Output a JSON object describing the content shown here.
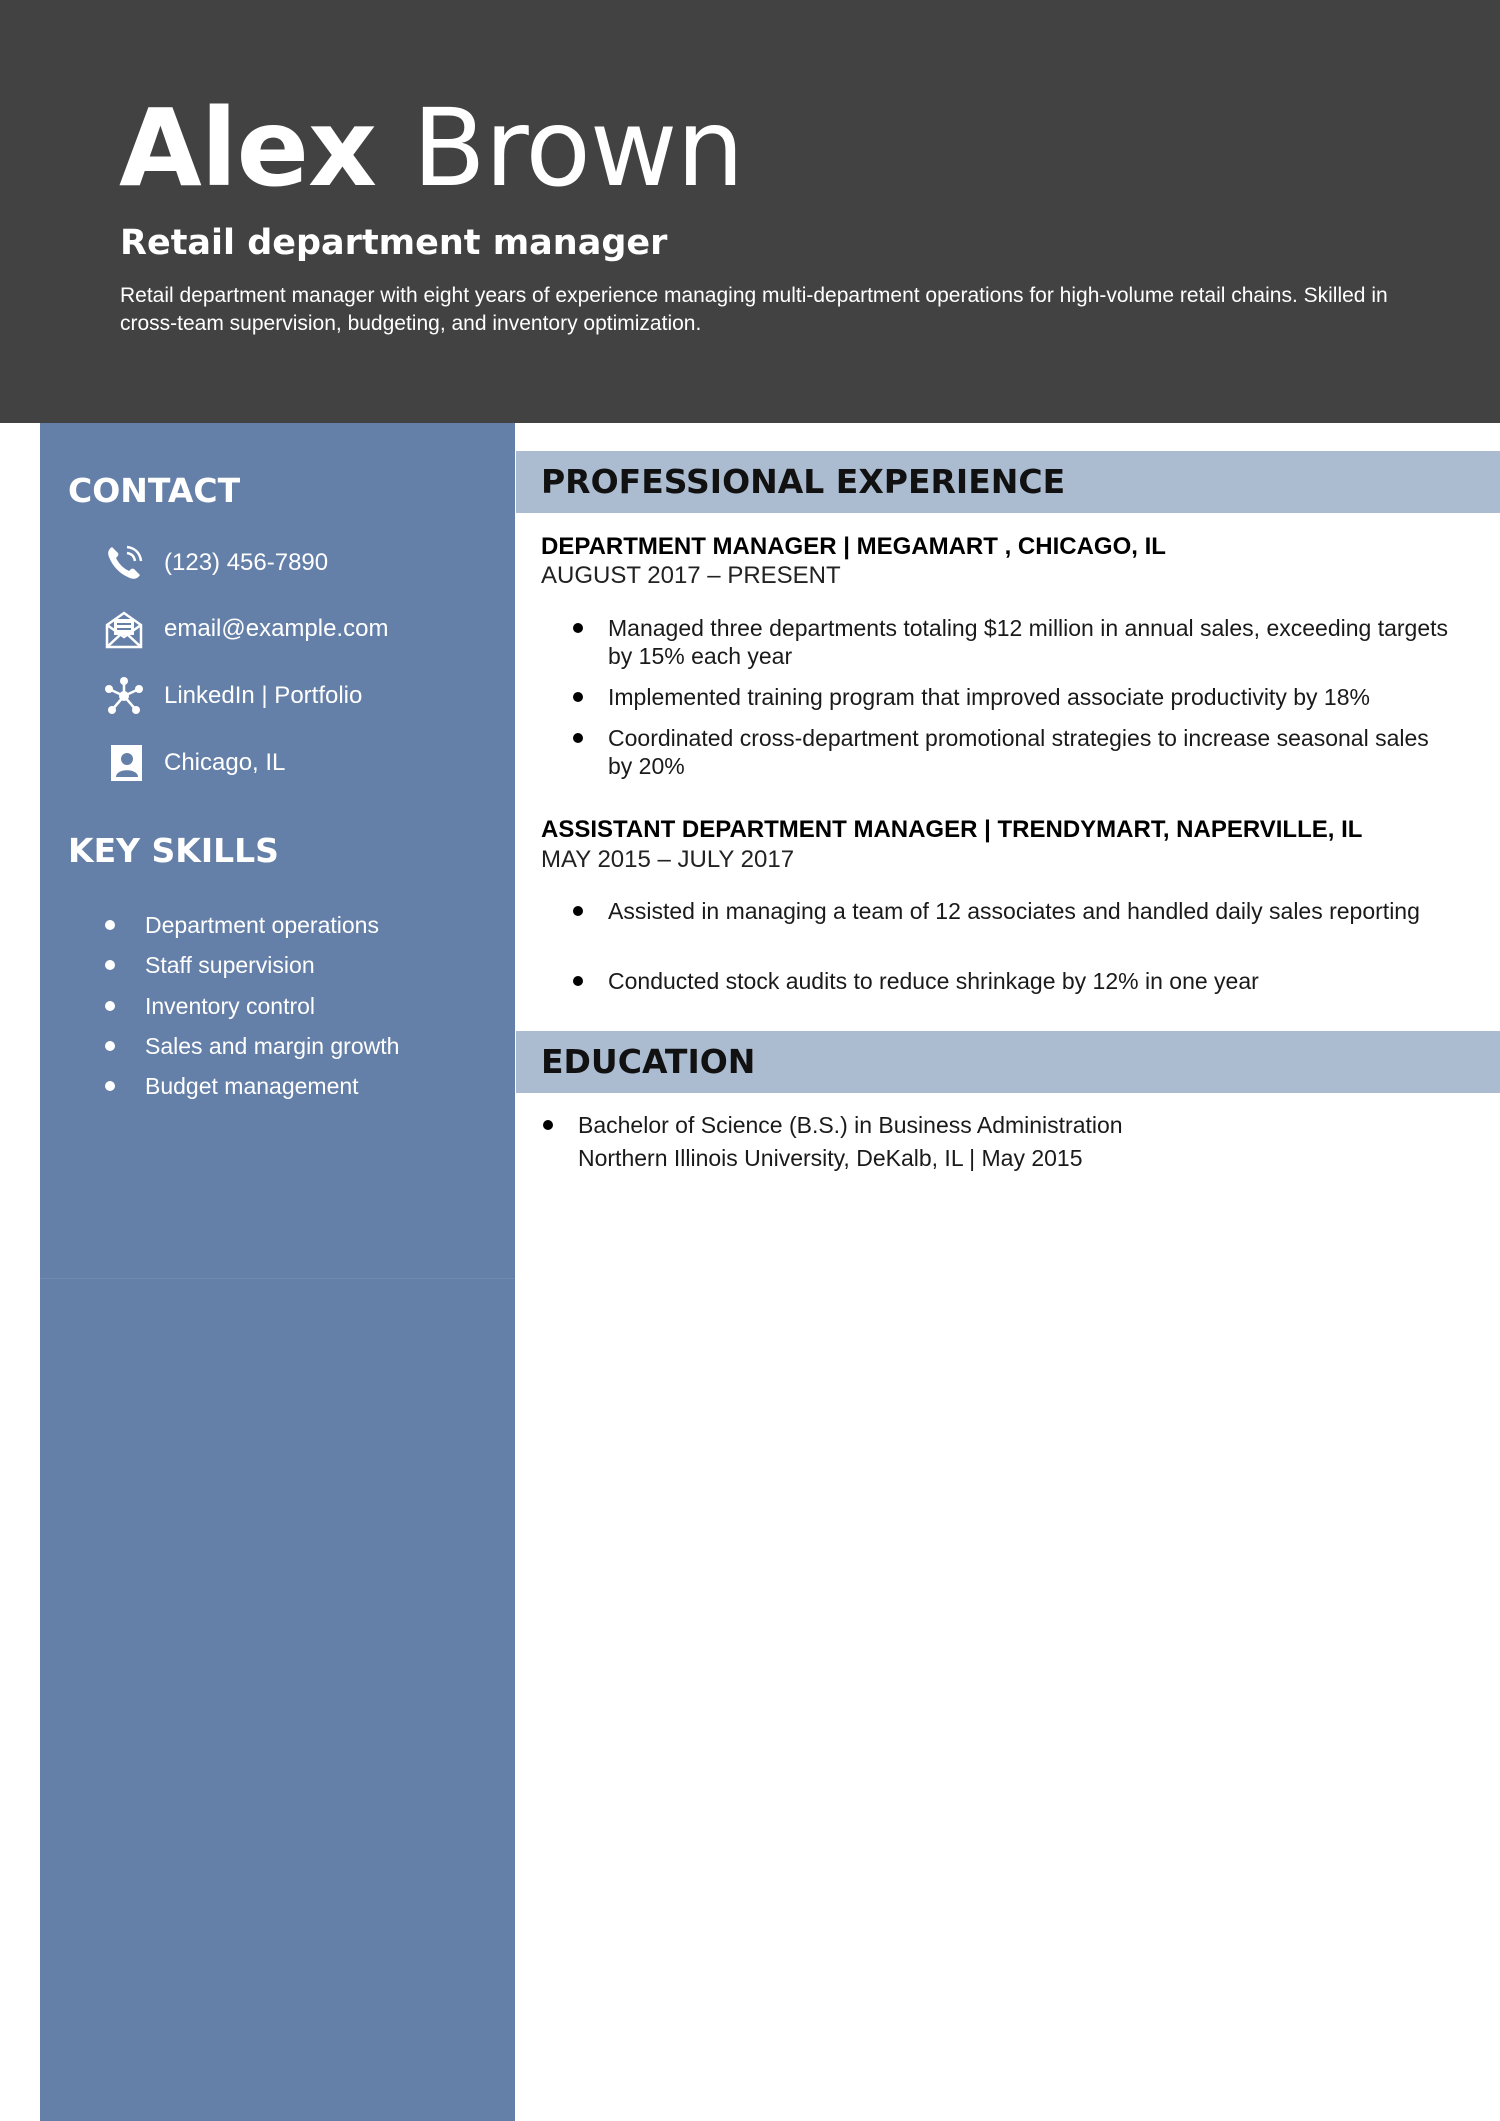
{
  "header": {
    "first_name": "Alex",
    "last_name": "Brown",
    "headline": "Retail department manager",
    "summary": "Retail department manager with eight years of experience managing multi-department operations for high-volume retail chains. Skilled in cross-team supervision, budgeting, and inventory optimization."
  },
  "sidebar": {
    "contact_heading": "CONTACT",
    "contact": [
      {
        "icon": "phone-icon",
        "text": "(123) 456-7890"
      },
      {
        "icon": "envelope-icon",
        "text": "email@example.com"
      },
      {
        "icon": "network-icon",
        "text": "LinkedIn | Portfolio"
      },
      {
        "icon": "contact-card-icon",
        "text": "Chicago, IL"
      }
    ],
    "skills_heading": "KEY SKILLS",
    "skills": [
      "Department operations",
      "Staff supervision",
      "Inventory control",
      "Sales and margin growth",
      "Budget management"
    ]
  },
  "experience": {
    "heading": "PROFESSIONAL EXPERIENCE",
    "jobs": [
      {
        "title": "DEPARTMENT MANAGER | MEGAMART , CHICAGO, IL",
        "dates": "AUGUST 2017 – PRESENT",
        "bullets": [
          "Managed three departments totaling $12 million in annual sales, exceeding targets by 15% each year",
          "Implemented training program that improved associate productivity by 18%",
          "Coordinated cross-department promotional strategies to increase seasonal sales by 20%"
        ]
      },
      {
        "title": "ASSISTANT DEPARTMENT MANAGER | TRENDYMART, NAPERVILLE, IL",
        "dates": "MAY 2015 – JULY 2017",
        "bullets": [
          "Assisted in managing a team of 12 associates and handled daily sales reporting",
          "Conducted stock audits to reduce shrinkage by 12% in one year"
        ]
      }
    ]
  },
  "education": {
    "heading": "EDUCATION",
    "degree": "Bachelor of Science (B.S.) in Business Administration",
    "school": "Northern Illinois University, DeKalb, IL | May 2015"
  },
  "colors": {
    "header_bg": "#424242",
    "sidebar_bg": "#6580a8",
    "section_bar_bg": "#abbcd1"
  }
}
